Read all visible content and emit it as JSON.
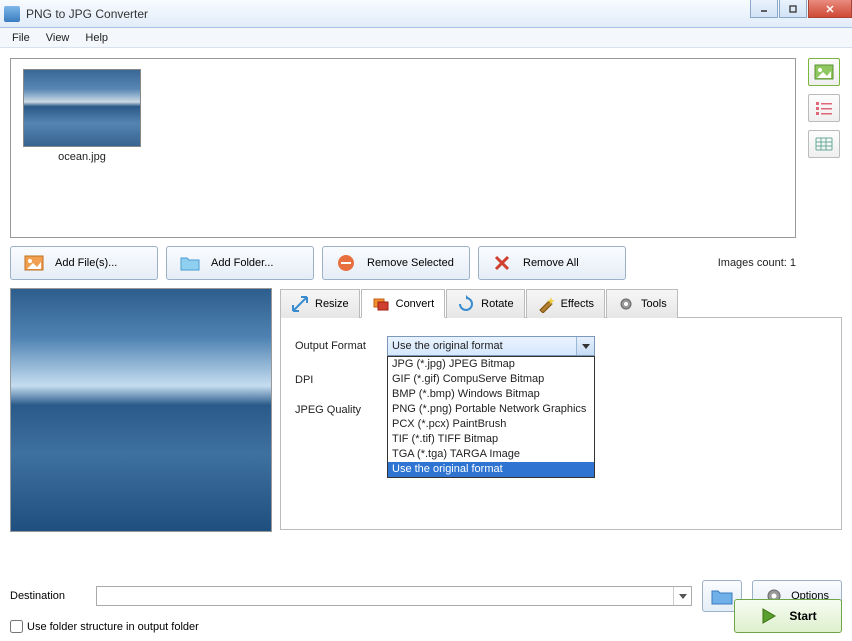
{
  "window": {
    "title": "PNG to JPG Converter"
  },
  "menu": {
    "file": "File",
    "view": "View",
    "help": "Help"
  },
  "thumb": {
    "name": "ocean.jpg"
  },
  "actions": {
    "add_files": "Add File(s)...",
    "add_folder": "Add Folder...",
    "remove_selected": "Remove Selected",
    "remove_all": "Remove All"
  },
  "images_count_label": "Images count: 1",
  "tabs": {
    "resize": "Resize",
    "convert": "Convert",
    "rotate": "Rotate",
    "effects": "Effects",
    "tools": "Tools"
  },
  "convert": {
    "output_format_label": "Output Format",
    "dpi_label": "DPI",
    "jpeg_quality_label": "JPEG Quality",
    "selected": "Use the original format",
    "options": [
      "JPG (*.jpg) JPEG Bitmap",
      "GIF (*.gif) CompuServe Bitmap",
      "BMP (*.bmp) Windows Bitmap",
      "PNG (*.png) Portable Network Graphics",
      "PCX (*.pcx) PaintBrush",
      "TIF (*.tif) TIFF Bitmap",
      "TGA (*.tga) TARGA Image",
      "Use the original format"
    ]
  },
  "bottom": {
    "destination_label": "Destination",
    "options_label": "Options",
    "use_folder_structure": "Use folder structure in output folder",
    "start": "Start"
  }
}
